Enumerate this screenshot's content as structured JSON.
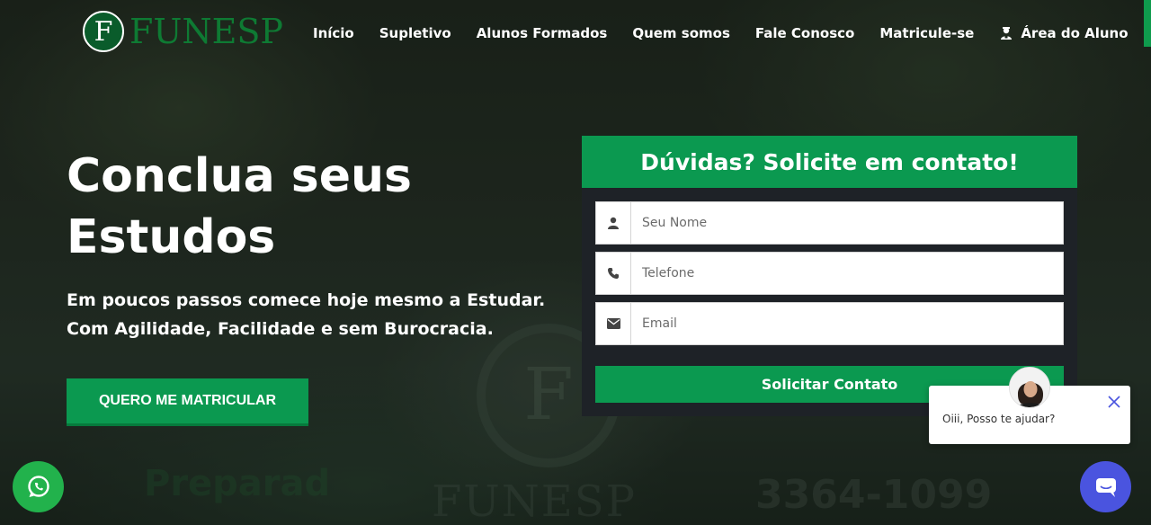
{
  "brand": {
    "logo_letter": "F",
    "name": "FUNESP",
    "primary_color": "#0b9950",
    "dark_green": "#0e7a33"
  },
  "nav": {
    "items": [
      {
        "label": "Início"
      },
      {
        "label": "Supletivo"
      },
      {
        "label": "Alunos Formados"
      },
      {
        "label": "Quem somos"
      },
      {
        "label": "Fale Conosco"
      },
      {
        "label": "Matricule-se"
      },
      {
        "label": "Área do Aluno",
        "icon": "student-icon"
      }
    ]
  },
  "hero": {
    "title_line1": "Conclua seus",
    "title_line2": "Estudos",
    "subtitle_line1": "Em poucos passos comece hoje mesmo a Estudar.",
    "subtitle_line2": "Com Agilidade, Facilidade e sem Burocracia.",
    "cta_label": "QUERO ME MATRICULAR"
  },
  "contact_form": {
    "heading": "Dúvidas? Solicite em contato!",
    "fields": [
      {
        "icon": "user-icon",
        "placeholder": "Seu Nome",
        "value": ""
      },
      {
        "icon": "phone-icon",
        "placeholder": "Telefone",
        "value": ""
      },
      {
        "icon": "envelope-icon",
        "placeholder": "Email",
        "value": ""
      }
    ],
    "submit_label": "Solicitar Contato"
  },
  "chat": {
    "message": "Oiii, Posso te ajudar?",
    "launcher_color": "#4a54df"
  },
  "whatsapp": {
    "color": "#22b24c"
  },
  "background_watermarks": {
    "seal_letter": "F",
    "brand": "FUNESP",
    "phone": "3364-1099",
    "slogan": "Preparad"
  }
}
